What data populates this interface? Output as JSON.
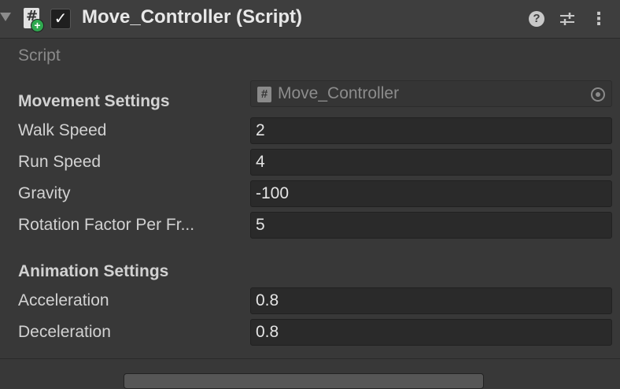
{
  "component": {
    "title": "Move_Controller (Script)",
    "enabled": "✓"
  },
  "icons": {
    "foldout": "triangle-down",
    "script": "#",
    "help": "?",
    "presets": "sliders",
    "menu": "⋮"
  },
  "script_row": {
    "label": "Script",
    "value": "Move_Controller"
  },
  "movement": {
    "header": "Movement Settings",
    "fields": [
      {
        "label": "Walk Speed",
        "value": "2"
      },
      {
        "label": "Run Speed",
        "value": "4"
      },
      {
        "label": "Gravity",
        "value": "-100"
      },
      {
        "label": "Rotation Factor Per Fr...",
        "value": "5"
      }
    ]
  },
  "animation": {
    "header": "Animation Settings",
    "fields": [
      {
        "label": "Acceleration",
        "value": "0.8"
      },
      {
        "label": "Deceleration",
        "value": "0.8"
      }
    ]
  }
}
